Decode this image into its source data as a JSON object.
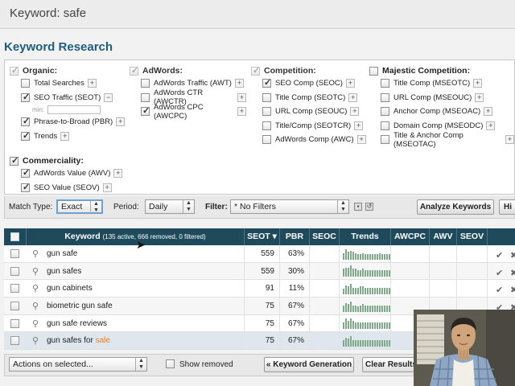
{
  "header": {
    "title": "Keyword: safe"
  },
  "section_title": "Keyword Research",
  "groups": {
    "organic": {
      "label": "Organic:",
      "checked": true,
      "items": [
        {
          "label": "Total Searches",
          "checked": false
        },
        {
          "label": "SEO Traffic (SEOT)",
          "checked": true
        },
        {
          "label": "Phrase-to-Broad (PBR)",
          "checked": true
        },
        {
          "label": "Trends",
          "checked": true
        }
      ],
      "min_label": "min:"
    },
    "adwords": {
      "label": "AdWords:",
      "checked": true,
      "items": [
        {
          "label": "AdWords Traffic (AWT)",
          "checked": false
        },
        {
          "label": "AdWords CTR (AWCTR)",
          "checked": false
        },
        {
          "label": "AdWords CPC (AWCPC)",
          "checked": true
        }
      ]
    },
    "competition": {
      "label": "Competition:",
      "checked": true,
      "items": [
        {
          "label": "SEO Comp (SEOC)",
          "checked": true
        },
        {
          "label": "Title Comp (SEOTC)",
          "checked": false
        },
        {
          "label": "URL Comp (SEOUC)",
          "checked": false
        },
        {
          "label": "Title/Comp (SEOTCR)",
          "checked": false
        },
        {
          "label": "AdWords Comp (AWC)",
          "checked": false
        }
      ]
    },
    "majestic": {
      "label": "Majestic Competition:",
      "checked": false,
      "items": [
        {
          "label": "Title Comp (MSEOTC)",
          "checked": false
        },
        {
          "label": "URL Comp (MSEOUC)",
          "checked": false
        },
        {
          "label": "Anchor Comp (MSEOAC)",
          "checked": false
        },
        {
          "label": "Domain Comp (MSEODC)",
          "checked": false
        },
        {
          "label": "Title & Anchor Comp (MSEOTAC)",
          "checked": false
        }
      ]
    },
    "commerciality": {
      "label": "Commerciality:",
      "checked": true,
      "items": [
        {
          "label": "AdWords Value (AWV)",
          "checked": true
        },
        {
          "label": "SEO Value (SEOV)",
          "checked": true
        }
      ]
    }
  },
  "toolbar": {
    "match_type_label": "Match Type:",
    "match_type_value": "Exact",
    "period_label": "Period:",
    "period_value": "Daily",
    "filter_label": "Filter:",
    "filter_value": "* No Filters",
    "analyze_label": "Analyze Keywords",
    "cut_label": "Hi"
  },
  "table": {
    "headers": {
      "keyword": "Keyword",
      "keyword_meta": "(135 active, 666 removed, 0 filtered)",
      "seot": "SEOT ▾",
      "pbr": "PBR",
      "seoc": "SEOC",
      "trends": "Trends",
      "awcpc": "AWCPC",
      "awv": "AWV",
      "seov": "SEOV"
    },
    "rows": [
      {
        "pre": "gun safe",
        "hl": "",
        "seot": "559",
        "pbr": "63%",
        "trend": [
          0.6,
          0.9,
          0.7,
          0.8,
          0.7,
          0.6,
          0.5,
          0.5,
          0.6,
          0.5,
          0.5,
          0.5,
          0.5,
          0.5,
          0.5,
          0.6,
          0.5,
          0.5,
          0.5,
          0.5
        ]
      },
      {
        "pre": "gun safes",
        "hl": "",
        "seot": "559",
        "pbr": "30%",
        "trend": [
          0.7,
          0.8,
          0.8,
          1.0,
          0.7,
          0.7,
          0.6,
          0.6,
          0.7,
          0.6,
          0.6,
          0.6,
          0.6,
          0.6,
          0.6,
          0.6,
          0.6,
          0.6,
          0.6,
          0.6
        ]
      },
      {
        "pre": "gun cabinets",
        "hl": "",
        "seot": "91",
        "pbr": "11%",
        "trend": [
          0.5,
          0.8,
          0.7,
          0.9,
          0.6,
          0.6,
          0.6,
          0.7,
          0.7,
          0.6,
          0.6,
          0.6,
          0.6,
          0.6,
          0.6,
          0.6,
          0.6,
          0.6,
          0.6,
          0.6
        ]
      },
      {
        "pre": "biometric gun safe",
        "hl": "",
        "seot": "75",
        "pbr": "67%",
        "trend": [
          0.6,
          0.8,
          0.7,
          0.9,
          0.6,
          0.6,
          0.5,
          0.6,
          0.7,
          0.6,
          0.6,
          0.6,
          0.6,
          0.6,
          0.6,
          0.6,
          0.6,
          0.6,
          0.6,
          0.6
        ]
      },
      {
        "pre": "gun safe reviews",
        "hl": "",
        "seot": "75",
        "pbr": "67%",
        "trend": [
          0.6,
          0.9,
          0.7,
          0.9,
          0.7,
          0.6,
          0.6,
          0.6,
          0.6,
          0.6,
          0.6,
          0.6,
          0.6,
          0.6,
          0.6,
          0.6,
          0.6,
          0.6,
          0.6,
          0.6
        ]
      },
      {
        "pre": "gun safes for ",
        "hl": "sale",
        "seot": "75",
        "pbr": "67%",
        "trend": [
          0.6,
          0.8,
          0.7,
          0.9,
          0.6,
          0.6,
          0.6,
          0.6,
          0.6,
          0.6,
          0.6,
          0.6,
          0.6,
          0.6,
          0.6,
          0.6,
          0.6,
          0.6,
          0.6,
          0.6
        ]
      }
    ]
  },
  "footer": {
    "actions_value": "Actions on selected...",
    "show_removed_label": "Show removed",
    "keyword_generation_label": "« Keyword Generation",
    "clear_results_label": "Clear Results"
  },
  "colors": {
    "header_bg": "#1e4a5c",
    "title": "#1f5e7e",
    "highlight": "#e0802a"
  }
}
